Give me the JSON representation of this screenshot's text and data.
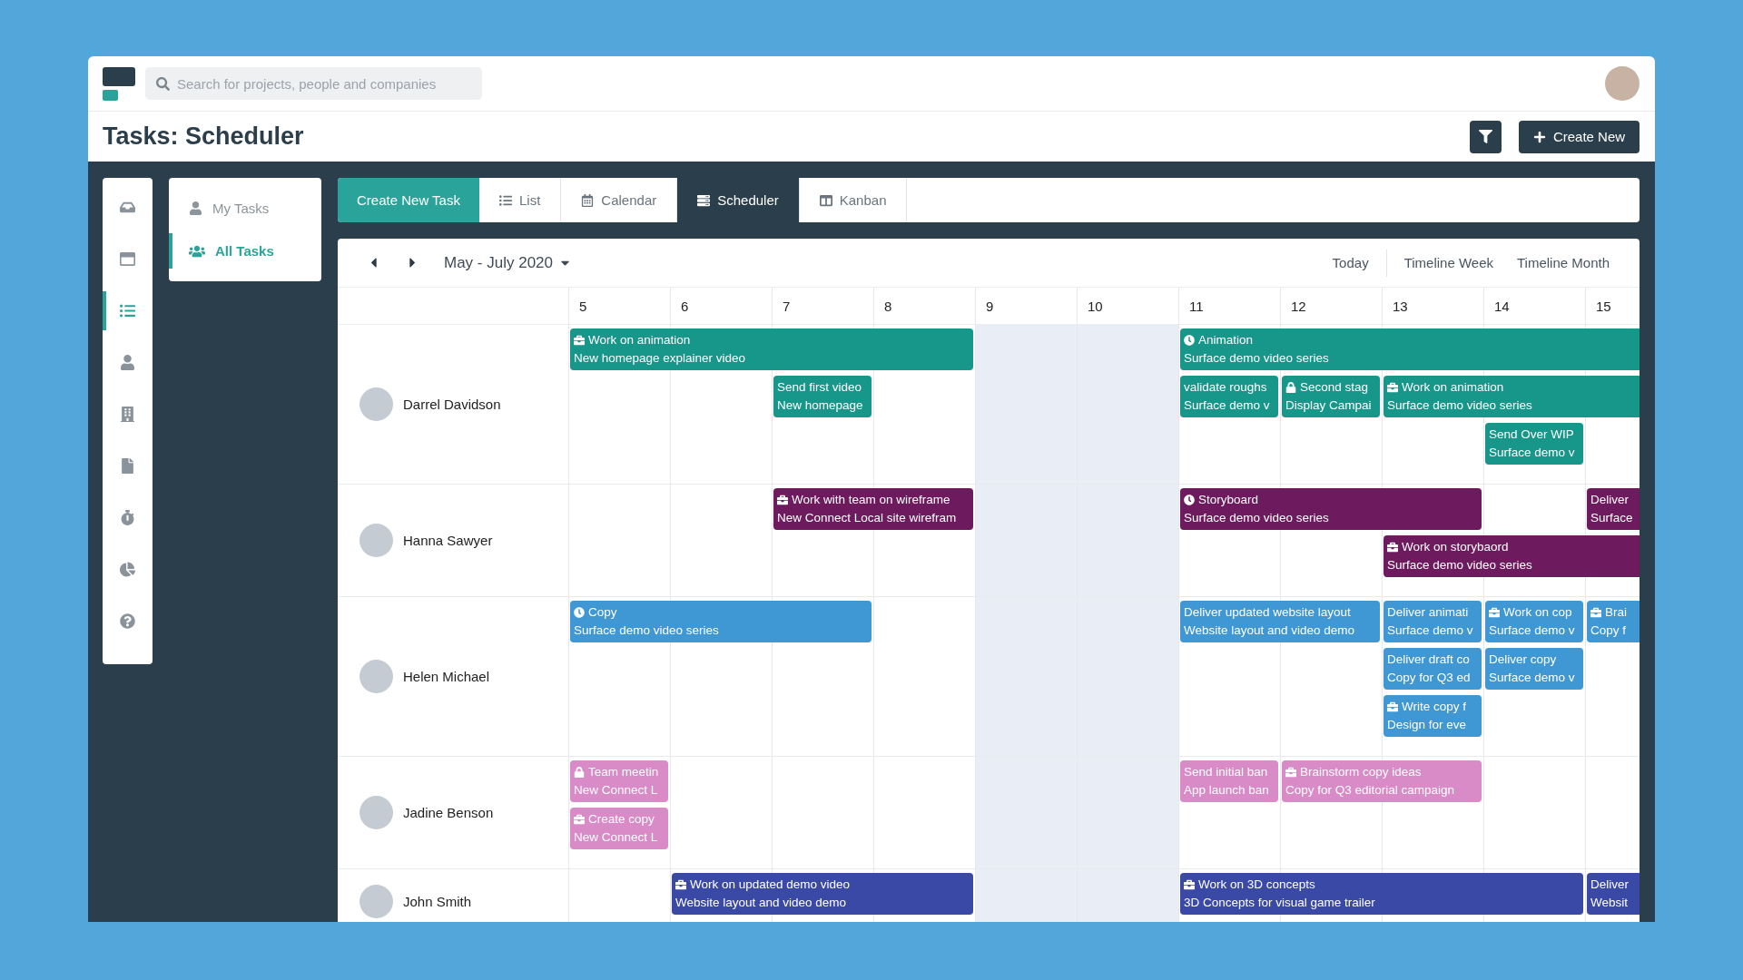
{
  "top_bar": {
    "search": {
      "placeholder": "Search for projects, people and companies"
    }
  },
  "header": {
    "title": "Tasks: Scheduler",
    "create_button": "Create New"
  },
  "sidebar": {
    "items": [
      {
        "selected": false
      },
      {
        "selected": false
      },
      {
        "selected": true
      },
      {
        "selected": false
      },
      {
        "selected": false
      },
      {
        "selected": false
      },
      {
        "selected": false
      },
      {
        "selected": false
      },
      {
        "selected": false
      }
    ]
  },
  "task_nav": {
    "items": [
      {
        "label": "My Tasks",
        "selected": false
      },
      {
        "label": "All Tasks",
        "selected": true
      }
    ]
  },
  "view_bar": {
    "create_button": "Create New Task",
    "tabs": [
      {
        "label": "List",
        "selected": false
      },
      {
        "label": "Calendar",
        "selected": false
      },
      {
        "label": "Scheduler",
        "selected": true
      },
      {
        "label": "Kanban",
        "selected": false
      }
    ]
  },
  "scheduler": {
    "range": "May - July 2020",
    "view_buttons": [
      "Today",
      "Timeline Week",
      "Timeline Month"
    ],
    "days": [
      {
        "label": "5",
        "weekend": false
      },
      {
        "label": "6",
        "weekend": false
      },
      {
        "label": "7",
        "weekend": false
      },
      {
        "label": "8",
        "weekend": false
      },
      {
        "label": "9",
        "weekend": true
      },
      {
        "label": "10",
        "weekend": true
      },
      {
        "label": "11",
        "weekend": false
      },
      {
        "label": "12",
        "weekend": false
      },
      {
        "label": "13",
        "weekend": false
      },
      {
        "label": "14",
        "weekend": false
      },
      {
        "label": "15",
        "weekend": false
      }
    ],
    "resources": [
      {
        "name": "Darrel Davidson",
        "color": "#17968a",
        "lanes": [
          [
            {
              "kind": "work",
              "title": "Work on animation",
              "subtitle": "New homepage explainer video"
            },
            {
              "kind": "continued"
            },
            {
              "kind": "continued"
            },
            {
              "kind": "continued"
            },
            {
              "kind": "empty"
            },
            {
              "kind": "empty"
            },
            {
              "kind": "phase",
              "title": "Animation",
              "subtitle": "Surface demo video series"
            },
            {
              "kind": "continued"
            },
            {
              "kind": "continued"
            },
            {
              "kind": "continued"
            },
            {
              "kind": "continued"
            }
          ],
          [
            {
              "kind": "empty"
            },
            {
              "kind": "empty"
            },
            {
              "kind": "plain",
              "title": "Send first video",
              "subtitle": "New homepage"
            },
            {
              "kind": "empty"
            },
            {
              "kind": "empty"
            },
            {
              "kind": "empty"
            },
            {
              "kind": "plain",
              "title": "validate roughs",
              "subtitle": "Surface demo v"
            },
            {
              "kind": "locked",
              "title": "Second stag",
              "subtitle": "Display Campai"
            },
            {
              "kind": "work",
              "title": "Work on animation",
              "subtitle": "Surface demo video series"
            },
            {
              "kind": "continued"
            },
            {
              "kind": "continued"
            }
          ],
          [
            {
              "kind": "empty"
            },
            {
              "kind": "empty"
            },
            {
              "kind": "empty"
            },
            {
              "kind": "empty"
            },
            {
              "kind": "empty"
            },
            {
              "kind": "empty"
            },
            {
              "kind": "empty"
            },
            {
              "kind": "empty"
            },
            {
              "kind": "empty"
            },
            {
              "kind": "plain",
              "title": "Send Over WIP",
              "subtitle": "Surface demo v"
            },
            {
              "kind": "empty"
            }
          ]
        ]
      },
      {
        "name": "Hanna Sawyer",
        "color": "#6d1b5e",
        "lanes": [
          [
            {
              "kind": "empty"
            },
            {
              "kind": "empty"
            },
            {
              "kind": "work",
              "title": "Work with team on wireframe",
              "subtitle": "New Connect Local site wirefram"
            },
            {
              "kind": "continued"
            },
            {
              "kind": "empty"
            },
            {
              "kind": "empty"
            },
            {
              "kind": "phase",
              "title": "Storyboard",
              "subtitle": "Surface demo video series"
            },
            {
              "kind": "continued"
            },
            {
              "kind": "continued"
            },
            {
              "kind": "empty"
            },
            {
              "kind": "plain",
              "title": "Deliver",
              "subtitle": "Surface"
            }
          ],
          [
            {
              "kind": "empty"
            },
            {
              "kind": "empty"
            },
            {
              "kind": "empty"
            },
            {
              "kind": "empty"
            },
            {
              "kind": "empty"
            },
            {
              "kind": "empty"
            },
            {
              "kind": "empty"
            },
            {
              "kind": "empty"
            },
            {
              "kind": "work",
              "title": "Work on storybaord",
              "subtitle": "Surface demo video series"
            },
            {
              "kind": "continued"
            },
            {
              "kind": "continued"
            }
          ]
        ]
      },
      {
        "name": "Helen Michael",
        "color": "#3f97d4",
        "lanes": [
          [
            {
              "kind": "phase",
              "title": "Copy",
              "subtitle": "Surface demo video series"
            },
            {
              "kind": "continued"
            },
            {
              "kind": "continued"
            },
            {
              "kind": "empty"
            },
            {
              "kind": "empty"
            },
            {
              "kind": "empty"
            },
            {
              "kind": "plain",
              "title": "Deliver updated website layout",
              "subtitle": "Website layout and video demo"
            },
            {
              "kind": "continued"
            },
            {
              "kind": "plain",
              "title": "Deliver animati",
              "subtitle": "Surface demo v"
            },
            {
              "kind": "work",
              "title": "Work on cop",
              "subtitle": "Surface demo v"
            },
            {
              "kind": "work",
              "title": "Brai",
              "subtitle": "Copy f"
            }
          ],
          [
            {
              "kind": "empty"
            },
            {
              "kind": "empty"
            },
            {
              "kind": "empty"
            },
            {
              "kind": "empty"
            },
            {
              "kind": "empty"
            },
            {
              "kind": "empty"
            },
            {
              "kind": "empty"
            },
            {
              "kind": "empty"
            },
            {
              "kind": "plain",
              "title": "Deliver draft co",
              "subtitle": "Copy for Q3 ed"
            },
            {
              "kind": "plain",
              "title": "Deliver copy",
              "subtitle": "Surface demo v"
            },
            {
              "kind": "empty"
            }
          ],
          [
            {
              "kind": "empty"
            },
            {
              "kind": "empty"
            },
            {
              "kind": "empty"
            },
            {
              "kind": "empty"
            },
            {
              "kind": "empty"
            },
            {
              "kind": "empty"
            },
            {
              "kind": "empty"
            },
            {
              "kind": "empty"
            },
            {
              "kind": "work",
              "title": "Write copy f",
              "subtitle": "Design for eve"
            },
            {
              "kind": "empty"
            },
            {
              "kind": "empty"
            }
          ]
        ]
      },
      {
        "name": "Jadine Benson",
        "color": "#d98bc8",
        "lanes": [
          [
            {
              "kind": "locked",
              "title": "Team meetin",
              "subtitle": "New Connect L"
            },
            {
              "kind": "empty"
            },
            {
              "kind": "empty"
            },
            {
              "kind": "empty"
            },
            {
              "kind": "empty"
            },
            {
              "kind": "empty"
            },
            {
              "kind": "plain",
              "title": "Send initial ban",
              "subtitle": "App launch ban"
            },
            {
              "kind": "work",
              "title": "Brainstorm copy ideas",
              "subtitle": "Copy for Q3 editorial campaign"
            },
            {
              "kind": "continued"
            },
            {
              "kind": "empty"
            },
            {
              "kind": "empty"
            }
          ],
          [
            {
              "kind": "work",
              "title": "Create copy",
              "subtitle": "New Connect L"
            },
            {
              "kind": "empty"
            },
            {
              "kind": "empty"
            },
            {
              "kind": "empty"
            },
            {
              "kind": "empty"
            },
            {
              "kind": "empty"
            },
            {
              "kind": "empty"
            },
            {
              "kind": "empty"
            },
            {
              "kind": "empty"
            },
            {
              "kind": "empty"
            },
            {
              "kind": "empty"
            }
          ]
        ]
      },
      {
        "name": "John Smith",
        "color": "#3b49a6",
        "lanes": [
          [
            {
              "kind": "empty"
            },
            {
              "kind": "work",
              "title": "Work on updated demo video",
              "subtitle": "Website layout and video demo"
            },
            {
              "kind": "continued"
            },
            {
              "kind": "continued"
            },
            {
              "kind": "empty"
            },
            {
              "kind": "empty"
            },
            {
              "kind": "work",
              "title": "Work on 3D concepts",
              "subtitle": "3D Concepts for visual game trailer"
            },
            {
              "kind": "continued"
            },
            {
              "kind": "continued"
            },
            {
              "kind": "continued"
            },
            {
              "kind": "plain",
              "title": "Deliver",
              "subtitle": "Websit"
            }
          ]
        ]
      }
    ]
  }
}
